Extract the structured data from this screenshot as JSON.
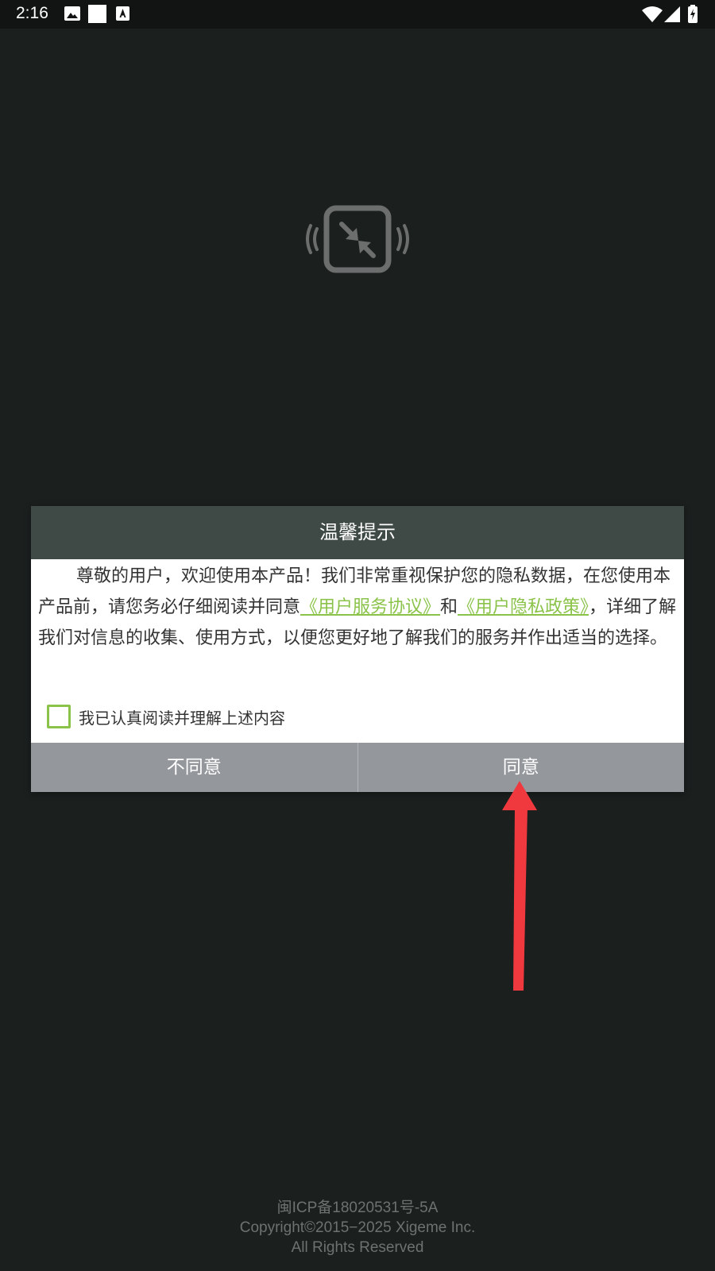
{
  "status_bar": {
    "time": "2:16",
    "left_icons": [
      "image-icon",
      "white-square-icon",
      "font-icon"
    ],
    "right_icons": [
      "wifi-icon",
      "signal-icon",
      "battery-charging-icon"
    ]
  },
  "app_logo": {
    "icon": "screen-shrink-icon",
    "color": "#6b6e6d"
  },
  "dialog": {
    "title": "温馨提示",
    "body": {
      "text_before_link1": "尊敬的用户，欢迎使用本产品！我们非常重视保护您的隐私数据，在您使用本产品前，请您务必仔细阅读并同意",
      "link1": "《用户服务协议》",
      "text_between_links": "和",
      "link2": "《用户隐私政策》",
      "text_after_link2": "，详细了解我们对信息的收集、使用方式，以便您更好地了解我们的服务并作出适当的选择。"
    },
    "agree_checkbox_label": "我已认真阅读并理解上述内容",
    "disagree_label": "不同意",
    "agree_label": "同意",
    "colors": {
      "header_bg": "#3f4a46",
      "link": "#8bc34a",
      "buttons_bg": "#94979c"
    }
  },
  "footer": {
    "line1": "闽ICP备18020531号-5A",
    "line2": "Copyright©2015−2025 Xigeme Inc.",
    "line3": "All Rights Reserved"
  }
}
